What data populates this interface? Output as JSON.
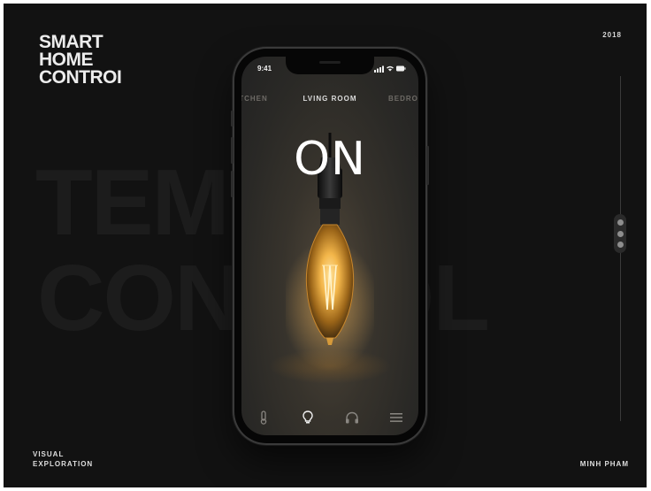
{
  "brand": {
    "line1": "SMART",
    "line2": "HOME",
    "line3": "CONTROI"
  },
  "year": "2018",
  "footer": {
    "left_line1": "VISUAL",
    "left_line2": "EXPLORATION",
    "right": "MINH PHAM"
  },
  "background_words": [
    "TEM",
    "CONTROL"
  ],
  "phone": {
    "time": "9:41",
    "tabs": {
      "left": "ITCHEN",
      "active": "LVING ROOM",
      "right": "BEDRO"
    },
    "state": "ON",
    "nav_icons": [
      "thermometer-icon",
      "bulb-icon",
      "headphones-icon",
      "menu-icon"
    ],
    "active_nav": "bulb-icon"
  },
  "colors": {
    "background": "#121212",
    "text": "#ececec",
    "bulb_glow": "#f3b64a"
  }
}
